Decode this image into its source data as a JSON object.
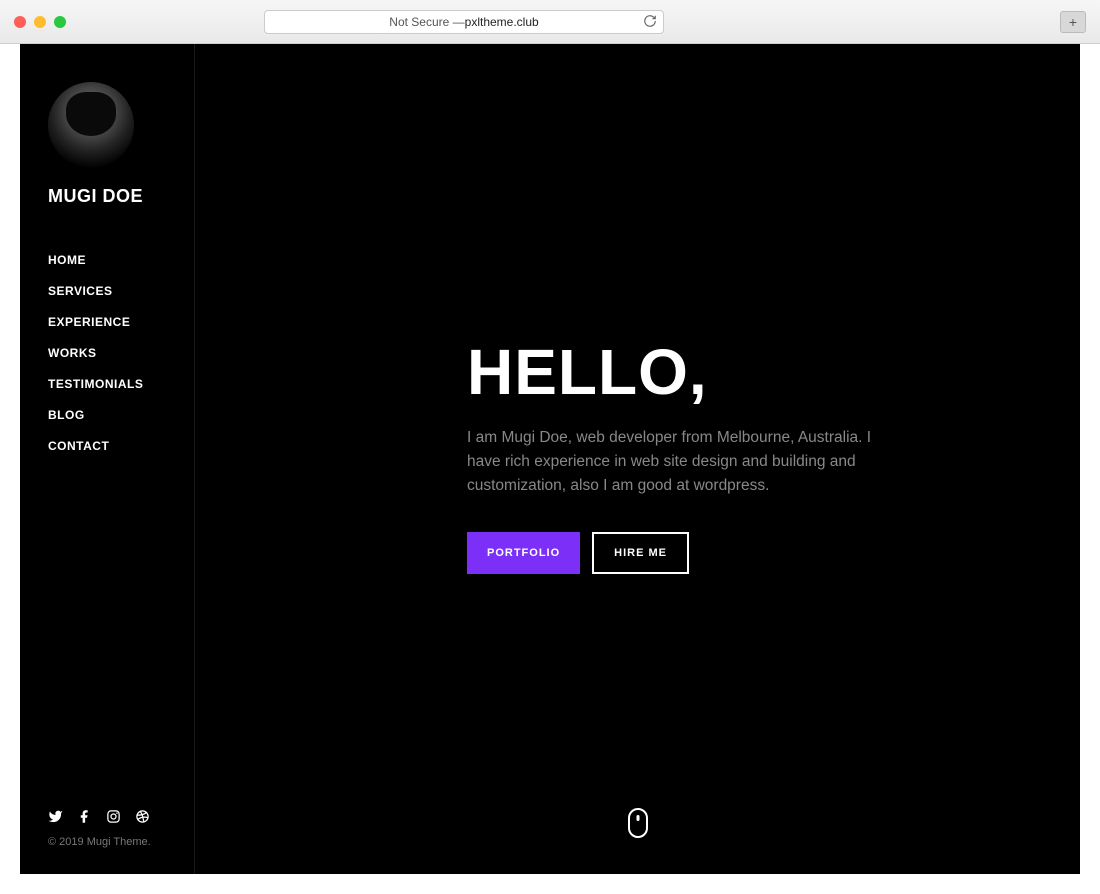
{
  "browser": {
    "security_label": "Not Secure — ",
    "domain": "pxltheme.club"
  },
  "sidebar": {
    "title": "MUGI DOE",
    "nav": [
      {
        "label": "HOME"
      },
      {
        "label": "SERVICES"
      },
      {
        "label": "EXPERIENCE"
      },
      {
        "label": "WORKS"
      },
      {
        "label": "TESTIMONIALS"
      },
      {
        "label": "BLOG"
      },
      {
        "label": "CONTACT"
      }
    ],
    "social": [
      {
        "icon": "twitter-icon"
      },
      {
        "icon": "facebook-icon"
      },
      {
        "icon": "instagram-icon"
      },
      {
        "icon": "dribbble-icon"
      }
    ],
    "copyright": "© 2019 Mugi Theme."
  },
  "hero": {
    "title": "HELLO,",
    "description": "I am Mugi Doe, web developer from Melbourne, Australia. I have rich experience in web site design and building and customization, also I am good at wordpress.",
    "primary_button": "PORTFOLIO",
    "secondary_button": "HIRE ME"
  },
  "colors": {
    "accent": "#7b2ff7"
  }
}
